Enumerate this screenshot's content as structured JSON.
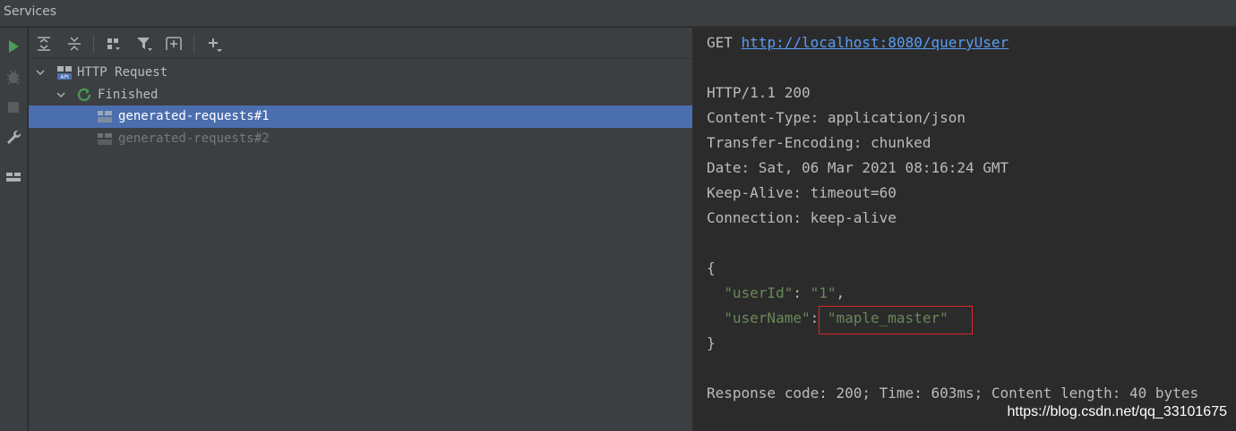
{
  "window": {
    "title": "Services"
  },
  "left_strip": {
    "icons": [
      "run-icon",
      "debug-icon",
      "stop-icon",
      "wrench-icon",
      "layout-icon"
    ]
  },
  "toolbar": {
    "icons": [
      "expand-all-icon",
      "collapse-all-icon",
      "group-by-icon",
      "filter-icon",
      "new-tab-icon",
      "add-icon"
    ]
  },
  "tree": {
    "root": {
      "label": "HTTP Request",
      "icon": "api-icon"
    },
    "group": {
      "label": "Finished",
      "icon": "refresh-icon"
    },
    "items": [
      {
        "label": "generated-requests#1",
        "selected": true
      },
      {
        "label": "generated-requests#2",
        "selected": false
      }
    ]
  },
  "console": {
    "method": "GET",
    "url": "http://localhost:8080/queryUser",
    "status_line": "HTTP/1.1 200",
    "headers": [
      "Content-Type: application/json",
      "Transfer-Encoding: chunked",
      "Date: Sat, 06 Mar 2021 08:16:24 GMT",
      "Keep-Alive: timeout=60",
      "Connection: keep-alive"
    ],
    "json_open": "{",
    "json_close": "}",
    "fields": [
      {
        "key": "\"userId\"",
        "value": "\"1\"",
        "trail": ","
      },
      {
        "key": "\"userName\"",
        "value": "\"maple_master\"",
        "trail": ""
      }
    ],
    "summary": "Response code: 200; Time: 603ms; Content length: 40 bytes"
  },
  "watermark": "https://blog.csdn.net/qq_33101675",
  "colors": {
    "accent_selection": "#4b6eaf",
    "url": "#589df6",
    "json_string": "#6a8759",
    "json_key": "#9876aa",
    "highlight_box": "#e0242b"
  }
}
